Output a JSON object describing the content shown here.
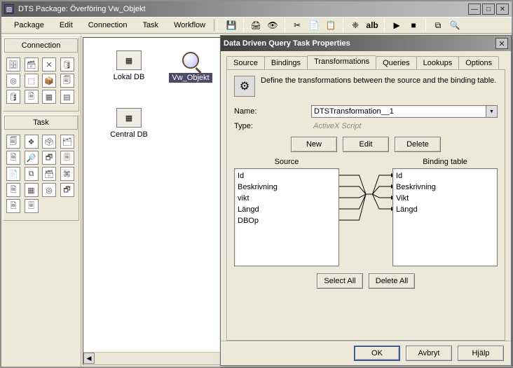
{
  "window": {
    "title": "DTS Package: Överföring Vw_Objekt"
  },
  "menus": [
    "Package",
    "Edit",
    "Connection",
    "Task",
    "Workflow"
  ],
  "toolbar": {
    "save": "💾",
    "print": "🖨",
    "preview": "👁",
    "cut": "✂",
    "copy": "📄",
    "paste": "📋",
    "alb_glyph": "❈",
    "alb": "alb",
    "play": "▶",
    "stop": "■",
    "tree": "⧉",
    "zoom": "🔍"
  },
  "sidebar": {
    "connection_header": "Connection",
    "task_header": "Task",
    "conn_glyphs": [
      "🗄",
      "🗃",
      "✕",
      "🛢",
      "◎",
      "⬚",
      "📦",
      "🗐",
      "🛢",
      "🗎",
      "▦",
      "▤"
    ],
    "task_glyphs": [
      "🗐",
      "❖",
      "🗳",
      "🗂",
      "🗎",
      "🔎",
      "🗗",
      "🗏",
      "📄",
      "⧉",
      "🗃",
      "⌘",
      "🗎",
      "▦",
      "◎",
      "🗗",
      "🗎",
      "🗏"
    ]
  },
  "canvas": {
    "items": [
      {
        "label": "Lokal DB"
      },
      {
        "label": "Vw_Objekt"
      },
      {
        "label": "Central DB"
      }
    ]
  },
  "dialog": {
    "title": "Data Driven Query Task Properties",
    "tabs": [
      "Source",
      "Bindings",
      "Transformations",
      "Queries",
      "Lookups",
      "Options"
    ],
    "active_tab": "Transformations",
    "desc": "Define the transformations between the source and the binding table.",
    "name_label": "Name:",
    "name_value": "DTSTransformation__1",
    "type_label": "Type:",
    "type_value": "ActiveX Script",
    "buttons": {
      "new": "New",
      "edit": "Edit",
      "delete": "Delete",
      "select_all": "Select All",
      "delete_all": "Delete All",
      "ok": "OK",
      "cancel": "Avbryt",
      "help": "Hjälp"
    },
    "source_header": "Source",
    "binding_header": "Binding table",
    "source_fields": [
      "Id",
      "Beskrivning",
      "vikt",
      "Längd",
      "DBOp"
    ],
    "binding_fields": [
      "Id",
      "Beskrivning",
      "Vikt",
      "Längd"
    ]
  }
}
